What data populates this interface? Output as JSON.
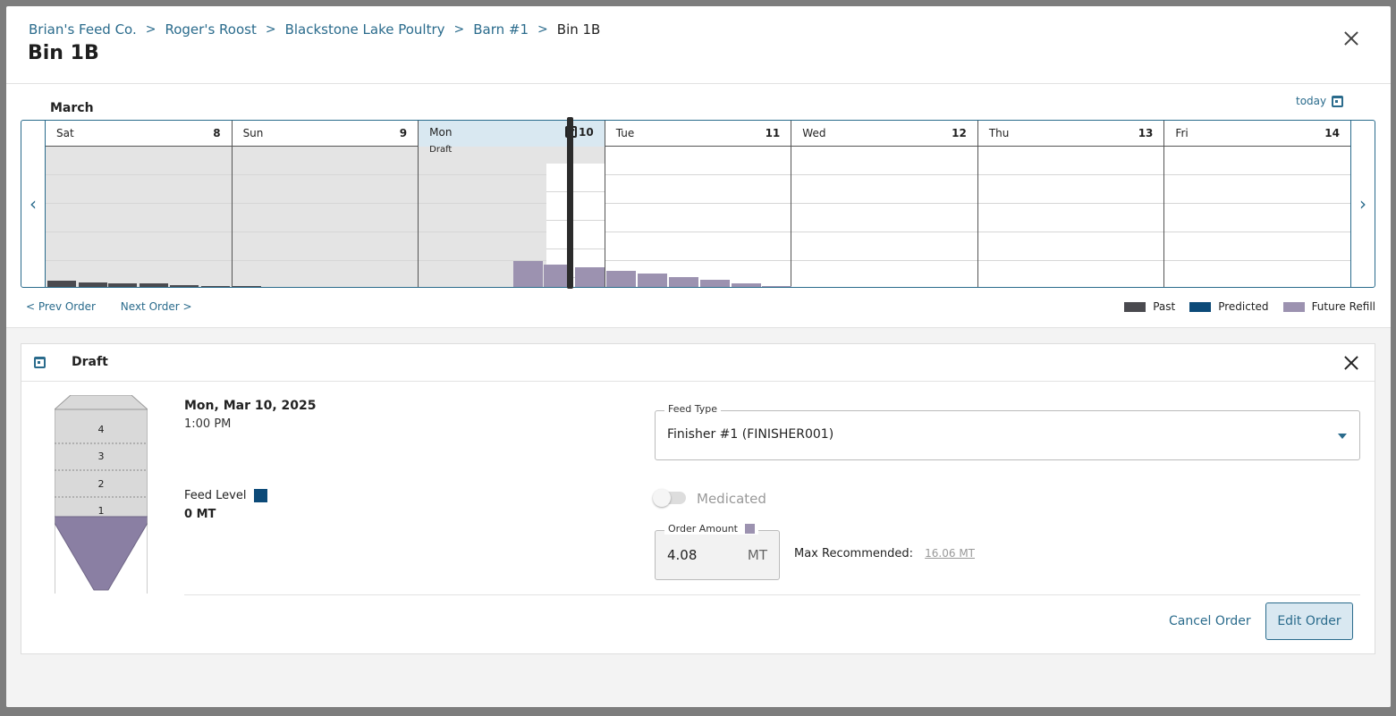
{
  "breadcrumb": [
    {
      "label": "Brian's Feed Co."
    },
    {
      "label": "Roger's Roost"
    },
    {
      "label": "Blackstone Lake Poultry"
    },
    {
      "label": "Barn #1"
    }
  ],
  "breadcrumb_current": "Bin 1B",
  "page_title": "Bin 1B",
  "calendar": {
    "month": "March",
    "today_label": "today",
    "days": [
      {
        "name": "Sat",
        "num": "8",
        "state": "past"
      },
      {
        "name": "Sun",
        "num": "9",
        "state": "past"
      },
      {
        "name": "Mon",
        "num": "10",
        "state": "selected",
        "tag": "Draft"
      },
      {
        "name": "Tue",
        "num": "11",
        "state": "future"
      },
      {
        "name": "Wed",
        "num": "12",
        "state": "future"
      },
      {
        "name": "Thu",
        "num": "13",
        "state": "future"
      },
      {
        "name": "Fri",
        "num": "14",
        "state": "future"
      }
    ],
    "prev_order": "< Prev Order",
    "next_order": "Next Order >"
  },
  "legend": [
    {
      "label": "Past",
      "color": "#4a4a4f"
    },
    {
      "label": "Predicted",
      "color": "#0c4a78"
    },
    {
      "label": "Future Refill",
      "color": "#9c92b0"
    }
  ],
  "draft": {
    "title": "Draft",
    "date": "Mon, Mar 10, 2025",
    "time": "1:00 PM",
    "feed_level_label": "Feed Level",
    "feed_level_value": "0 MT",
    "feed_level_color": "#0c4a78",
    "silo_levels": [
      "4",
      "3",
      "2",
      "1"
    ],
    "feed_type_label": "Feed Type",
    "feed_type_value": "Finisher #1 (FINISHER001)",
    "medicated_label": "Medicated",
    "order_amount_label": "Order Amount",
    "order_amount_color": "#9c92b0",
    "order_amount_value": "4.08",
    "order_amount_unit": "MT",
    "max_recommended_label": "Max Recommended:",
    "max_recommended_value": "16.06 MT",
    "cancel_label": "Cancel Order",
    "edit_label": "Edit Order"
  }
}
